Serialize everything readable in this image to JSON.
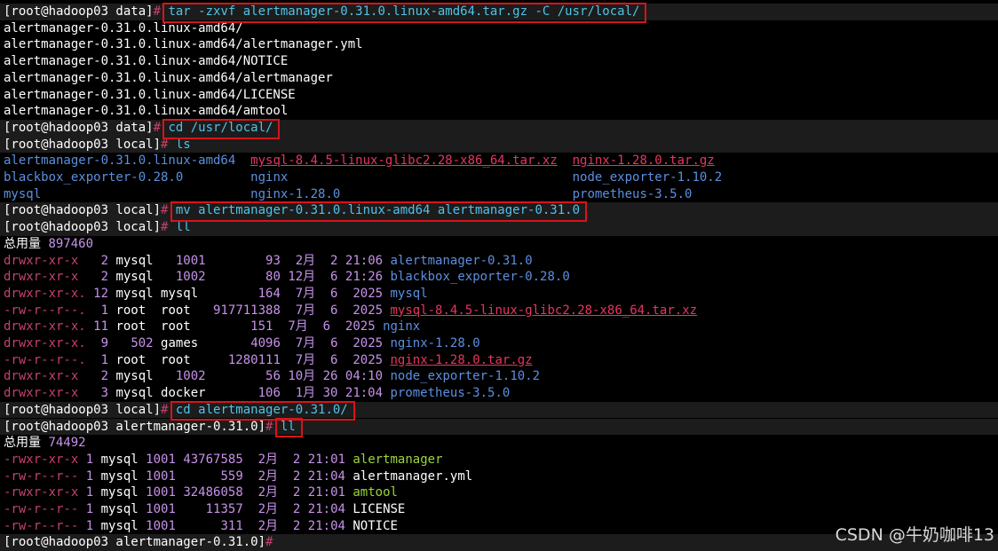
{
  "colors": {
    "background": "#000000",
    "prompt_bg": "#1c1c1c",
    "text": "#ffffff",
    "command": "#4fc3e8",
    "directory": "#5c8fe0",
    "archive": "#e7365f",
    "executable": "#9bd53a",
    "perm": "#c6416e",
    "number": "#c792ea",
    "highlight_box": "#d7141a"
  },
  "lines": [
    {
      "prompt": true,
      "parts": [
        {
          "t": "[root@hadoop03 data]",
          "c": "text"
        },
        {
          "t": "# ",
          "c": "perm"
        },
        {
          "t": "tar -zxvf alertmanager-0.31.0.linux-amd64.tar.gz -C /usr/local/",
          "c": "command"
        }
      ]
    },
    {
      "parts": [
        {
          "t": "alertmanager-0.31.0.linux-amd64/",
          "c": "text"
        }
      ]
    },
    {
      "parts": [
        {
          "t": "alertmanager-0.31.0.linux-amd64/alertmanager.yml",
          "c": "text"
        }
      ]
    },
    {
      "parts": [
        {
          "t": "alertmanager-0.31.0.linux-amd64/NOTICE",
          "c": "text"
        }
      ]
    },
    {
      "parts": [
        {
          "t": "alertmanager-0.31.0.linux-amd64/alertmanager",
          "c": "text"
        }
      ]
    },
    {
      "parts": [
        {
          "t": "alertmanager-0.31.0.linux-amd64/LICENSE",
          "c": "text"
        }
      ]
    },
    {
      "parts": [
        {
          "t": "alertmanager-0.31.0.linux-amd64/amtool",
          "c": "text"
        }
      ]
    },
    {
      "prompt": true,
      "parts": [
        {
          "t": "[root@hadoop03 data]",
          "c": "text"
        },
        {
          "t": "# ",
          "c": "perm"
        },
        {
          "t": "cd /usr/local/",
          "c": "command"
        }
      ]
    },
    {
      "prompt": true,
      "parts": [
        {
          "t": "[root@hadoop03 local]",
          "c": "text"
        },
        {
          "t": "# ",
          "c": "perm"
        },
        {
          "t": "ls",
          "c": "command"
        }
      ]
    },
    {
      "parts": [
        {
          "t": "alertmanager-0.31.0.linux-amd64  ",
          "c": "directory"
        },
        {
          "t": "mysql-8.4.5-linux-glibc2.28-x86_64.tar.xz",
          "c": "archive",
          "u": true
        },
        {
          "t": "  ",
          "c": "text"
        },
        {
          "t": "nginx-1.28.0.tar.gz",
          "c": "archive",
          "u": true
        }
      ]
    },
    {
      "parts": [
        {
          "t": "blackbox_exporter-0.28.0         ",
          "c": "directory"
        },
        {
          "t": "nginx                                      ",
          "c": "directory"
        },
        {
          "t": "node_exporter-1.10.2",
          "c": "directory"
        }
      ]
    },
    {
      "parts": [
        {
          "t": "mysql                            ",
          "c": "directory"
        },
        {
          "t": "nginx-1.28.0                               ",
          "c": "directory"
        },
        {
          "t": "prometheus-3.5.0",
          "c": "directory"
        }
      ]
    },
    {
      "prompt": true,
      "parts": [
        {
          "t": "[root@hadoop03 local]",
          "c": "text"
        },
        {
          "t": "# ",
          "c": "perm"
        },
        {
          "t": "mv alertmanager-0.31.0.linux-amd64 alertmanager-0.31.0",
          "c": "command"
        }
      ]
    },
    {
      "prompt": true,
      "parts": [
        {
          "t": "[root@hadoop03 local]",
          "c": "text"
        },
        {
          "t": "# ",
          "c": "perm"
        },
        {
          "t": "ll",
          "c": "command"
        }
      ]
    },
    {
      "parts": [
        {
          "t": "总用量 ",
          "c": "text"
        },
        {
          "t": "897460",
          "c": "number"
        }
      ]
    },
    {
      "parts": [
        {
          "t": "drwxr-xr-x   ",
          "c": "perm"
        },
        {
          "t": "2",
          "c": "number"
        },
        {
          "t": " mysql   ",
          "c": "text"
        },
        {
          "t": "1001",
          "c": "number"
        },
        {
          "t": "        ",
          "c": "text"
        },
        {
          "t": "93",
          "c": "number"
        },
        {
          "t": "  2月  ",
          "c": "number"
        },
        {
          "t": "2 21:06 ",
          "c": "number"
        },
        {
          "t": "alertmanager-0.31.0",
          "c": "directory"
        }
      ]
    },
    {
      "parts": [
        {
          "t": "drwxr-xr-x   ",
          "c": "perm"
        },
        {
          "t": "2",
          "c": "number"
        },
        {
          "t": " mysql   ",
          "c": "text"
        },
        {
          "t": "1002",
          "c": "number"
        },
        {
          "t": "        ",
          "c": "text"
        },
        {
          "t": "80",
          "c": "number"
        },
        {
          "t": " 12月  ",
          "c": "number"
        },
        {
          "t": "6 21:26 ",
          "c": "number"
        },
        {
          "t": "blackbox_exporter-0.28.0",
          "c": "directory"
        }
      ]
    },
    {
      "parts": [
        {
          "t": "drwxr-xr-x. ",
          "c": "perm"
        },
        {
          "t": "12",
          "c": "number"
        },
        {
          "t": " mysql mysql        ",
          "c": "text"
        },
        {
          "t": "164",
          "c": "number"
        },
        {
          "t": "  7月  ",
          "c": "number"
        },
        {
          "t": "6  2025 ",
          "c": "number"
        },
        {
          "t": "mysql",
          "c": "directory"
        }
      ]
    },
    {
      "parts": [
        {
          "t": "-rw-r--r--.  ",
          "c": "perm"
        },
        {
          "t": "1",
          "c": "number"
        },
        {
          "t": " root  root   ",
          "c": "text"
        },
        {
          "t": "917711388",
          "c": "number"
        },
        {
          "t": "  7月  ",
          "c": "number"
        },
        {
          "t": "6  2025 ",
          "c": "number"
        },
        {
          "t": "mysql-8.4.5-linux-glibc2.28-x86_64.tar.xz",
          "c": "archive",
          "u": true
        }
      ]
    },
    {
      "parts": [
        {
          "t": "drwxr-xr-x. ",
          "c": "perm"
        },
        {
          "t": "11",
          "c": "number"
        },
        {
          "t": " root  root        ",
          "c": "text"
        },
        {
          "t": "151",
          "c": "number"
        },
        {
          "t": "  7月  ",
          "c": "number"
        },
        {
          "t": "6  2025 ",
          "c": "number"
        },
        {
          "t": "nginx",
          "c": "directory"
        }
      ]
    },
    {
      "parts": [
        {
          "t": "drwxr-xr-x.  ",
          "c": "perm"
        },
        {
          "t": "9",
          "c": "number"
        },
        {
          "t": "   ",
          "c": "text"
        },
        {
          "t": "502",
          "c": "number"
        },
        {
          "t": " games       ",
          "c": "text"
        },
        {
          "t": "4096",
          "c": "number"
        },
        {
          "t": "  7月  ",
          "c": "number"
        },
        {
          "t": "6  2025 ",
          "c": "number"
        },
        {
          "t": "nginx-1.28.0",
          "c": "directory"
        }
      ]
    },
    {
      "parts": [
        {
          "t": "-rw-r--r--.  ",
          "c": "perm"
        },
        {
          "t": "1",
          "c": "number"
        },
        {
          "t": " root  root     ",
          "c": "text"
        },
        {
          "t": "1280111",
          "c": "number"
        },
        {
          "t": "  7月  ",
          "c": "number"
        },
        {
          "t": "6  2025 ",
          "c": "number"
        },
        {
          "t": "nginx-1.28.0.tar.gz",
          "c": "archive",
          "u": true
        }
      ]
    },
    {
      "parts": [
        {
          "t": "drwxr-xr-x   ",
          "c": "perm"
        },
        {
          "t": "2",
          "c": "number"
        },
        {
          "t": " mysql   ",
          "c": "text"
        },
        {
          "t": "1002",
          "c": "number"
        },
        {
          "t": "        ",
          "c": "text"
        },
        {
          "t": "56",
          "c": "number"
        },
        {
          "t": " 10月 ",
          "c": "number"
        },
        {
          "t": "26 04:10 ",
          "c": "number"
        },
        {
          "t": "node_exporter-1.10.2",
          "c": "directory"
        }
      ]
    },
    {
      "parts": [
        {
          "t": "drwxr-xr-x   ",
          "c": "perm"
        },
        {
          "t": "3",
          "c": "number"
        },
        {
          "t": " mysql docker       ",
          "c": "text"
        },
        {
          "t": "106",
          "c": "number"
        },
        {
          "t": "  1月 ",
          "c": "number"
        },
        {
          "t": "30 21:04 ",
          "c": "number"
        },
        {
          "t": "prometheus-3.5.0",
          "c": "directory"
        }
      ]
    },
    {
      "prompt": true,
      "parts": [
        {
          "t": "[root@hadoop03 local]",
          "c": "text"
        },
        {
          "t": "# ",
          "c": "perm"
        },
        {
          "t": "cd alertmanager-0.31.0/",
          "c": "command"
        }
      ]
    },
    {
      "prompt": true,
      "parts": [
        {
          "t": "[root@hadoop03 alertmanager-0.31.0]",
          "c": "text"
        },
        {
          "t": "# ",
          "c": "perm"
        },
        {
          "t": "ll",
          "c": "command"
        }
      ]
    },
    {
      "parts": [
        {
          "t": "总用量 ",
          "c": "text"
        },
        {
          "t": "74492",
          "c": "number"
        }
      ]
    },
    {
      "parts": [
        {
          "t": "-rwxr-xr-x ",
          "c": "perm"
        },
        {
          "t": "1",
          "c": "number"
        },
        {
          "t": " mysql ",
          "c": "text"
        },
        {
          "t": "1001",
          "c": "number"
        },
        {
          "t": " ",
          "c": "text"
        },
        {
          "t": "43767585",
          "c": "number"
        },
        {
          "t": "  2月  ",
          "c": "number"
        },
        {
          "t": "2 21:01 ",
          "c": "number"
        },
        {
          "t": "alertmanager",
          "c": "executable"
        }
      ]
    },
    {
      "parts": [
        {
          "t": "-rw-r--r-- ",
          "c": "perm"
        },
        {
          "t": "1",
          "c": "number"
        },
        {
          "t": " mysql ",
          "c": "text"
        },
        {
          "t": "1001",
          "c": "number"
        },
        {
          "t": "      ",
          "c": "text"
        },
        {
          "t": "559",
          "c": "number"
        },
        {
          "t": "  2月  ",
          "c": "number"
        },
        {
          "t": "2 21:04 ",
          "c": "number"
        },
        {
          "t": "alertmanager.yml",
          "c": "text"
        }
      ]
    },
    {
      "parts": [
        {
          "t": "-rwxr-xr-x ",
          "c": "perm"
        },
        {
          "t": "1",
          "c": "number"
        },
        {
          "t": " mysql ",
          "c": "text"
        },
        {
          "t": "1001",
          "c": "number"
        },
        {
          "t": " ",
          "c": "text"
        },
        {
          "t": "32486058",
          "c": "number"
        },
        {
          "t": "  2月  ",
          "c": "number"
        },
        {
          "t": "2 21:01 ",
          "c": "number"
        },
        {
          "t": "amtool",
          "c": "executable"
        }
      ]
    },
    {
      "parts": [
        {
          "t": "-rw-r--r-- ",
          "c": "perm"
        },
        {
          "t": "1",
          "c": "number"
        },
        {
          "t": " mysql ",
          "c": "text"
        },
        {
          "t": "1001",
          "c": "number"
        },
        {
          "t": "    ",
          "c": "text"
        },
        {
          "t": "11357",
          "c": "number"
        },
        {
          "t": "  2月  ",
          "c": "number"
        },
        {
          "t": "2 21:04 ",
          "c": "number"
        },
        {
          "t": "LICENSE",
          "c": "text"
        }
      ]
    },
    {
      "parts": [
        {
          "t": "-rw-r--r-- ",
          "c": "perm"
        },
        {
          "t": "1",
          "c": "number"
        },
        {
          "t": " mysql ",
          "c": "text"
        },
        {
          "t": "1001",
          "c": "number"
        },
        {
          "t": "      ",
          "c": "text"
        },
        {
          "t": "311",
          "c": "number"
        },
        {
          "t": "  2月  ",
          "c": "number"
        },
        {
          "t": "2 21:04 ",
          "c": "number"
        },
        {
          "t": "NOTICE",
          "c": "text"
        }
      ]
    },
    {
      "prompt": true,
      "parts": [
        {
          "t": "[root@hadoop03 alertmanager-0.31.0]",
          "c": "text"
        },
        {
          "t": "# ",
          "c": "perm"
        }
      ]
    }
  ],
  "highlighted_lines": [
    0,
    7,
    12,
    24,
    25
  ],
  "watermark": "CSDN @牛奶咖啡13"
}
